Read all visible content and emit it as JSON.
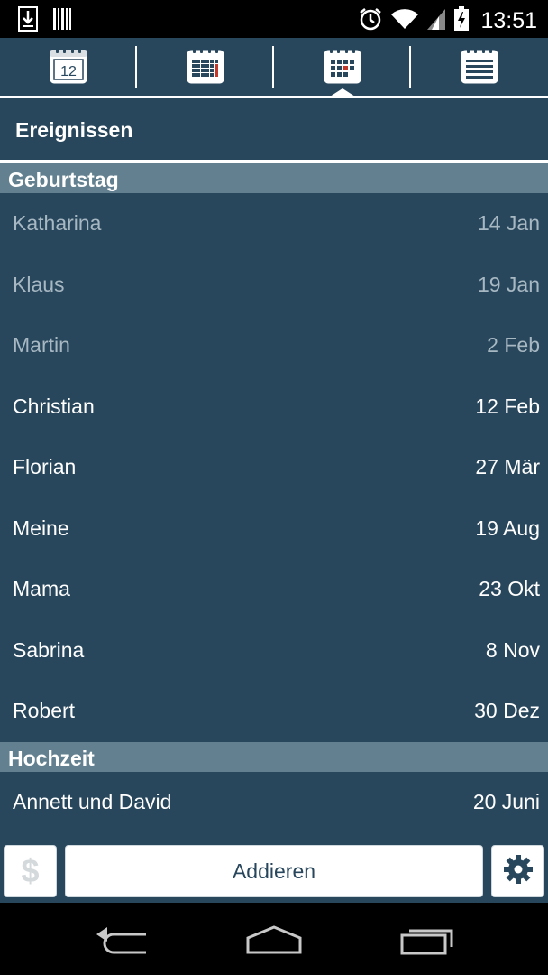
{
  "status_bar": {
    "time": "13:51",
    "icons": [
      "download-icon",
      "barcode-icon",
      "alarm-icon",
      "wifi-icon",
      "signal-icon",
      "battery-charging-icon"
    ]
  },
  "toolbar": {
    "tabs": [
      {
        "name": "calendar-day-icon",
        "label": "12",
        "selected": false
      },
      {
        "name": "calendar-month-icon",
        "selected": false
      },
      {
        "name": "calendar-events-icon",
        "selected": true
      },
      {
        "name": "list-icon",
        "selected": false
      }
    ]
  },
  "page": {
    "title": "Ereignissen"
  },
  "sections": [
    {
      "header": "Geburtstag",
      "items": [
        {
          "name": "Katharina",
          "date": "14 Jan",
          "past": true
        },
        {
          "name": "Klaus",
          "date": "19 Jan",
          "past": true
        },
        {
          "name": "Martin",
          "date": "2 Feb",
          "past": true
        },
        {
          "name": "Christian",
          "date": "12 Feb",
          "past": false
        },
        {
          "name": "Florian",
          "date": "27 Mär",
          "past": false
        },
        {
          "name": "Meine",
          "date": "19 Aug",
          "past": false
        },
        {
          "name": "Mama",
          "date": "23 Okt",
          "past": false
        },
        {
          "name": "Sabrina",
          "date": "8 Nov",
          "past": false
        },
        {
          "name": "Robert",
          "date": "30 Dez",
          "past": false
        }
      ]
    },
    {
      "header": "Hochzeit",
      "items": [
        {
          "name": "Annett und David",
          "date": "20 Juni",
          "past": false
        }
      ]
    }
  ],
  "bottom_bar": {
    "dollar_icon": "$",
    "add_label": "Addieren",
    "settings_icon": "gear-icon"
  },
  "nav_bar": {
    "buttons": [
      "back-icon",
      "home-icon",
      "recent-apps-icon"
    ]
  },
  "colors": {
    "background": "#28475c",
    "section_header": "#62808f",
    "past_text": "#a7b8c3",
    "accent_red": "#c0392b"
  }
}
